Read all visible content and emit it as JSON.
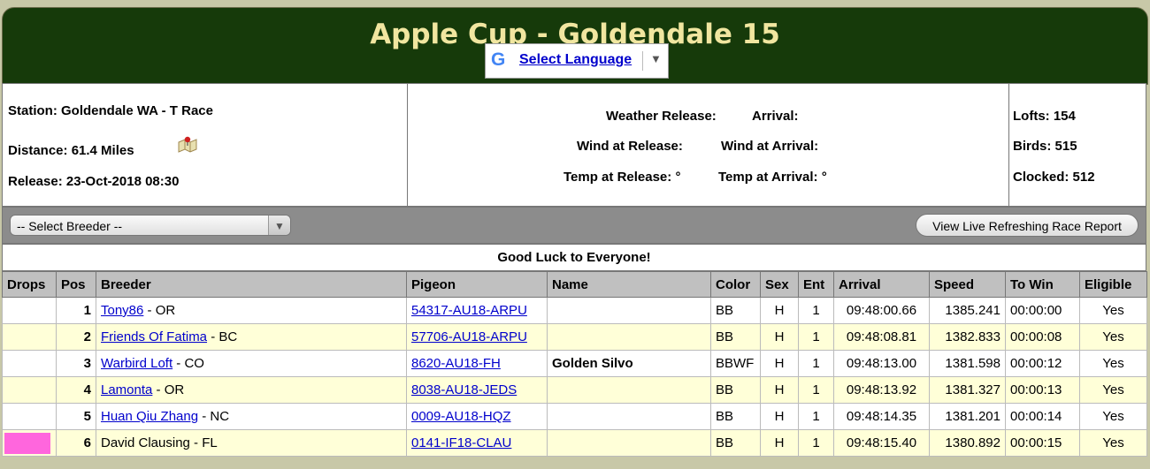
{
  "header": {
    "title": "Apple Cup - Goldendale 15",
    "language_link": "Select Language"
  },
  "info": {
    "station": "Station: Goldendale WA - T Race",
    "distance": "Distance: 61.4 Miles",
    "release": "Release: 23-Oct-2018 08:30",
    "weather_release": "Weather Release:",
    "arrival": "Arrival:",
    "wind_release": "Wind at Release:",
    "wind_arrival": "Wind at Arrival:",
    "temp_release": "Temp at Release: °",
    "temp_arrival": "Temp at Arrival: °",
    "lofts": "Lofts: 154",
    "birds": "Birds: 515",
    "clocked": "Clocked: 512"
  },
  "toolbar": {
    "breeder_select": "-- Select Breeder --",
    "live_button": "View Live Refreshing Race Report"
  },
  "message": "Good Luck to Everyone!",
  "columns": [
    "Drops",
    "Pos",
    "Breeder",
    "Pigeon",
    "Name",
    "Color",
    "Sex",
    "Ent",
    "Arrival",
    "Speed",
    "To Win",
    "Eligible"
  ],
  "rows": [
    {
      "drops": "",
      "pos": "1",
      "breeder": "Tony86",
      "breeder_linked": true,
      "state": " - OR",
      "pigeon": "54317-AU18-ARPU",
      "name": "",
      "color": "BB",
      "sex": "H",
      "ent": "1",
      "arrival": "09:48:00.66",
      "speed": "1385.241",
      "towin": "00:00:00",
      "eligible": "Yes"
    },
    {
      "drops": "",
      "pos": "2",
      "breeder": "Friends Of Fatima",
      "breeder_linked": true,
      "state": " - BC",
      "pigeon": "57706-AU18-ARPU",
      "name": "",
      "color": "BB",
      "sex": "H",
      "ent": "1",
      "arrival": "09:48:08.81",
      "speed": "1382.833",
      "towin": "00:00:08",
      "eligible": "Yes"
    },
    {
      "drops": "",
      "pos": "3",
      "breeder": "Warbird Loft",
      "breeder_linked": true,
      "state": " - CO",
      "pigeon": "8620-AU18-FH",
      "name": "Golden Silvo",
      "color": "BBWF",
      "sex": "H",
      "ent": "1",
      "arrival": "09:48:13.00",
      "speed": "1381.598",
      "towin": "00:00:12",
      "eligible": "Yes"
    },
    {
      "drops": "",
      "pos": "4",
      "breeder": "Lamonta",
      "breeder_linked": true,
      "state": " - OR",
      "pigeon": "8038-AU18-JEDS",
      "name": "",
      "color": "BB",
      "sex": "H",
      "ent": "1",
      "arrival": "09:48:13.92",
      "speed": "1381.327",
      "towin": "00:00:13",
      "eligible": "Yes"
    },
    {
      "drops": "",
      "pos": "5",
      "breeder": "Huan Qiu Zhang",
      "breeder_linked": true,
      "state": " - NC",
      "pigeon": "0009-AU18-HQZ",
      "name": "",
      "color": "BB",
      "sex": "H",
      "ent": "1",
      "arrival": "09:48:14.35",
      "speed": "1381.201",
      "towin": "00:00:14",
      "eligible": "Yes"
    },
    {
      "drops": "pink",
      "pos": "6",
      "breeder": "David Clausing",
      "breeder_linked": false,
      "state": " - FL",
      "pigeon": "0141-IF18-CLAU",
      "name": "",
      "color": "BB",
      "sex": "H",
      "ent": "1",
      "arrival": "09:48:15.40",
      "speed": "1380.892",
      "towin": "00:00:15",
      "eligible": "Yes"
    }
  ],
  "colors": {
    "header_bg": "#163a0a",
    "title_text": "#f1e6a0",
    "row_alt": "#ffffd8",
    "drop_marker": "#ff66dd",
    "link": "#0000cc"
  },
  "icons": {
    "google": "google-g-icon",
    "map": "map-pin-icon"
  }
}
